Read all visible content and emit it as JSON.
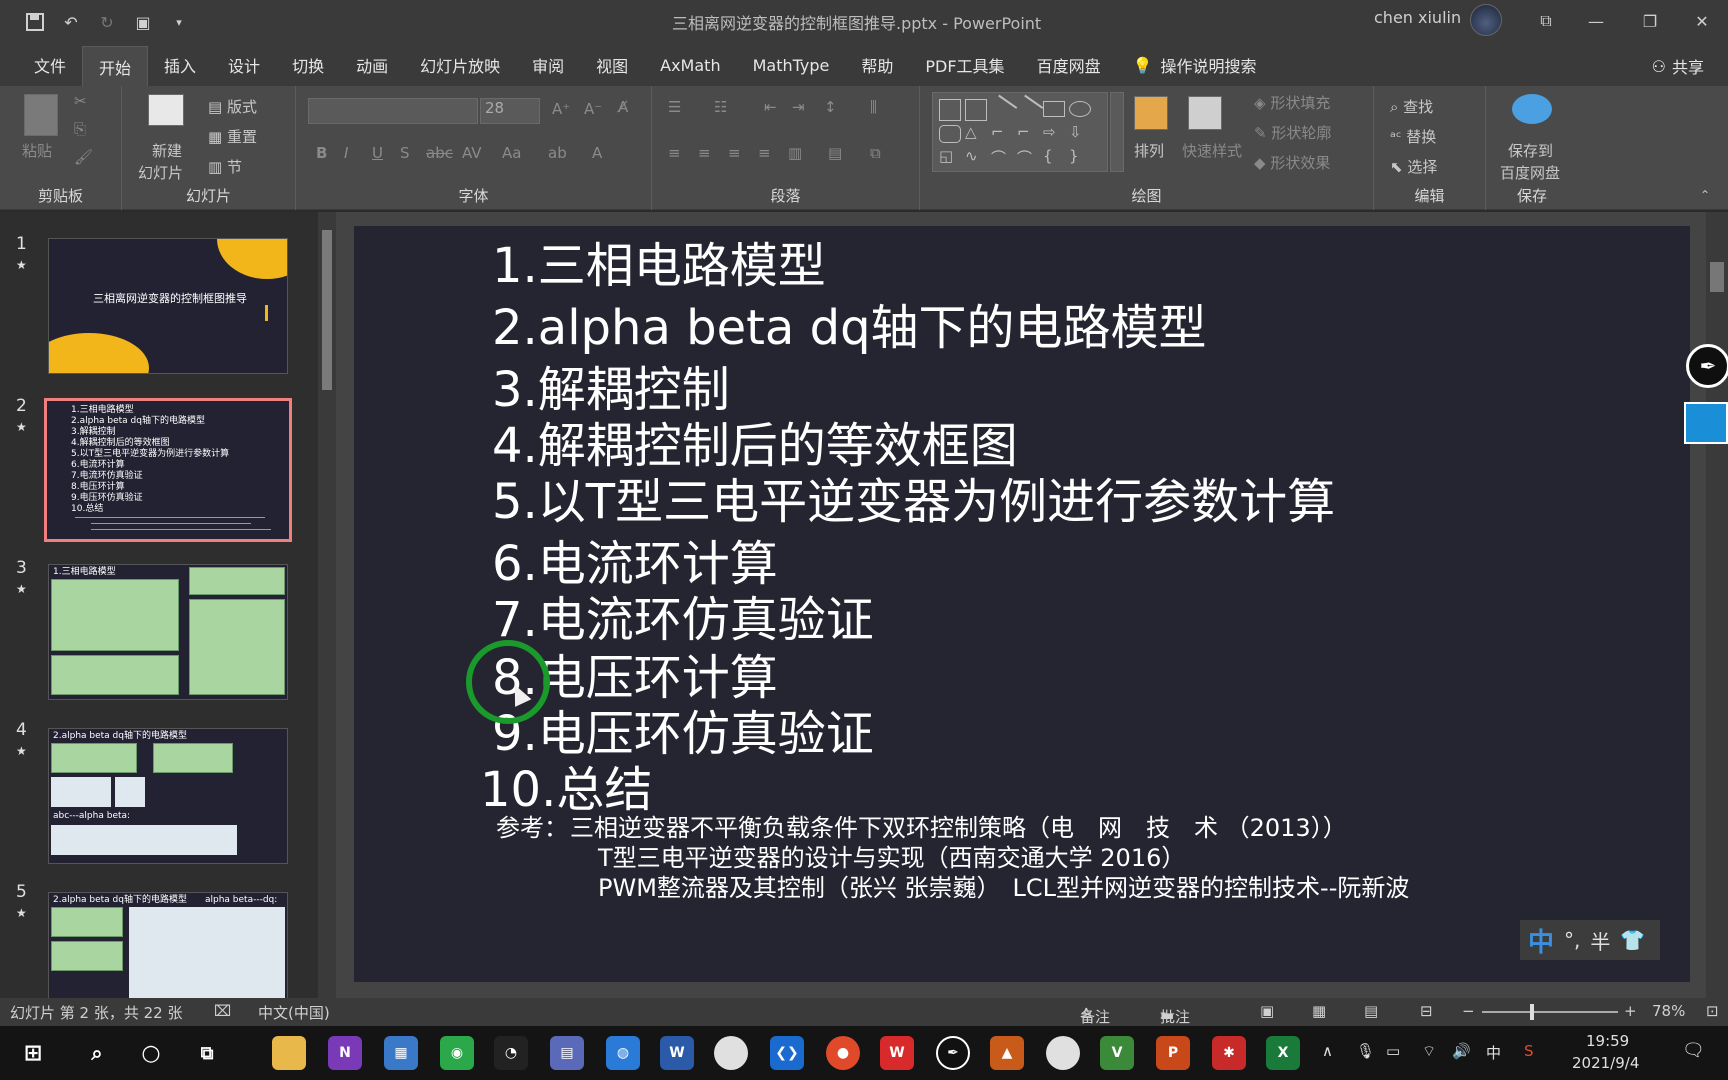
{
  "window": {
    "title": "三相离网逆变器的控制框图推导.pptx  -  PowerPoint",
    "user": "chen xiulin",
    "controls": {
      "minimize": "—",
      "restore": "❐",
      "close": "✕"
    },
    "ribbon_display": "⧉"
  },
  "tabs": [
    "文件",
    "开始",
    "插入",
    "设计",
    "切换",
    "动画",
    "幻灯片放映",
    "审阅",
    "视图",
    "AxMath",
    "MathType",
    "帮助",
    "PDF工具集",
    "百度网盘"
  ],
  "active_tab": "开始",
  "tell_me": "操作说明搜索",
  "share": "共享",
  "ribbon": {
    "clipboard": {
      "label": "剪贴板",
      "paste": "粘贴"
    },
    "slides": {
      "label": "幻灯片",
      "new_slide": "新建",
      "new_slide2": "幻灯片",
      "layout": "版式",
      "reset": "重置",
      "section": "节"
    },
    "font": {
      "label": "字体",
      "font_name": "",
      "font_size": "28"
    },
    "paragraph": {
      "label": "段落"
    },
    "drawing": {
      "label": "绘图",
      "arrange": "排列",
      "quick_styles": "快速样式",
      "shape_fill": "形状填充",
      "shape_outline": "形状轮廓",
      "shape_effects": "形状效果"
    },
    "editing": {
      "label": "编辑",
      "find": "查找",
      "replace": "替换",
      "select": "选择"
    },
    "save": {
      "label": "保存",
      "save_to": "保存到",
      "baidu": "百度网盘"
    }
  },
  "thumbnails": {
    "slide1_title": "三相离网逆变器的控制框图推导",
    "slide2_lines": [
      "1.三相电路模型",
      "2.alpha beta dq轴下的电路模型",
      "3.解耦控制",
      "4.解耦控制后的等效框图",
      "5.以T型三电平逆变器为例进行参数计算",
      "6.电流环计算",
      "7.电流环仿真验证",
      "8.电压环计算",
      "9.电压环仿真验证",
      "10.总结"
    ],
    "slide3_title": "1.三相电路模型",
    "slide4_title": "2.alpha beta dq轴下的电路模型",
    "slide4_sub": "abc---alpha beta:",
    "slide5_title": "2.alpha beta dq轴下的电路模型",
    "slide5_sub": "alpha beta---dq:"
  },
  "slide": {
    "items": [
      "1.三相电路模型",
      "2.alpha beta dq轴下的电路模型",
      "3.解耦控制",
      "4.解耦控制后的等效框图",
      "5.以T型三电平逆变器为例进行参数计算",
      "6.电流环计算",
      "7.电流环仿真验证",
      "8.电压环计算",
      "9.电压环仿真验证",
      "10.总结"
    ],
    "ref_label": "参考：",
    "refs": [
      "三相逆变器不平衡负载条件下双环控制策略（电　网　技　术 （2013））",
      "T型三电平逆变器的设计与实现（西南交通大学 2016）",
      "PWM整流器及其控制（张兴 张崇巍）　LCL型并网逆变器的控制技术--阮新波"
    ]
  },
  "ime": {
    "mode": "中",
    "punct": "°,",
    "width": "半"
  },
  "status": {
    "slide_info": "幻灯片 第 2 张，共 22 张",
    "language": "中文(中国)",
    "notes": "备注",
    "comments": "批注",
    "zoom": "78%"
  },
  "taskbar": {
    "time": "19:59",
    "date": "2021/9/4",
    "ime": "中"
  }
}
